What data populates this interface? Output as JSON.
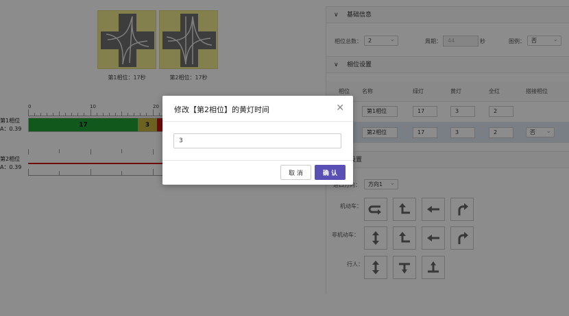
{
  "phases": [
    {
      "caption": "第1相位：17秒"
    },
    {
      "caption": "第2相位：17秒"
    }
  ],
  "timeline": {
    "ticks": [
      "0",
      "10",
      "20"
    ],
    "rows": [
      {
        "label": "第1相位",
        "sub": "A：0.39",
        "green": "17",
        "yellow": "3"
      },
      {
        "label": "第2相位",
        "sub": "A：0.39"
      }
    ]
  },
  "panel": {
    "basic": {
      "title": "基础信息",
      "total_label": "相位总数：",
      "total_value": "2",
      "cycle_label": "周期：",
      "cycle_value": "44",
      "cycle_unit": "秒",
      "legend_label": "图例：",
      "legend_value": "否"
    },
    "phase_settings": {
      "title": "相位设置",
      "columns": [
        "相位",
        "名称",
        "绿灯",
        "黄灯",
        "全红",
        "搭接相位"
      ],
      "rows": [
        {
          "name": "第1相位",
          "green": "17",
          "yellow": "3",
          "red": "2",
          "overlap": ""
        },
        {
          "name": "第2相位",
          "green": "17",
          "yellow": "3",
          "red": "2",
          "overlap": "否"
        }
      ]
    },
    "direction_settings": {
      "title_partial": "口设置",
      "direction_label_partial": "进口方向：",
      "direction_value": "方向1",
      "motor_label": "机动车：",
      "nonmotor_label": "非机动车：",
      "pedestrian_label": "行人："
    }
  },
  "modal": {
    "title": "修改【第2相位】的黄灯时间",
    "input_value": "3",
    "cancel_label": "取 消",
    "ok_label": "确 认"
  },
  "colors": {
    "green": "#1fa035",
    "yellow": "#c9b340",
    "red": "#c81414",
    "accent": "#5a4fb5"
  }
}
